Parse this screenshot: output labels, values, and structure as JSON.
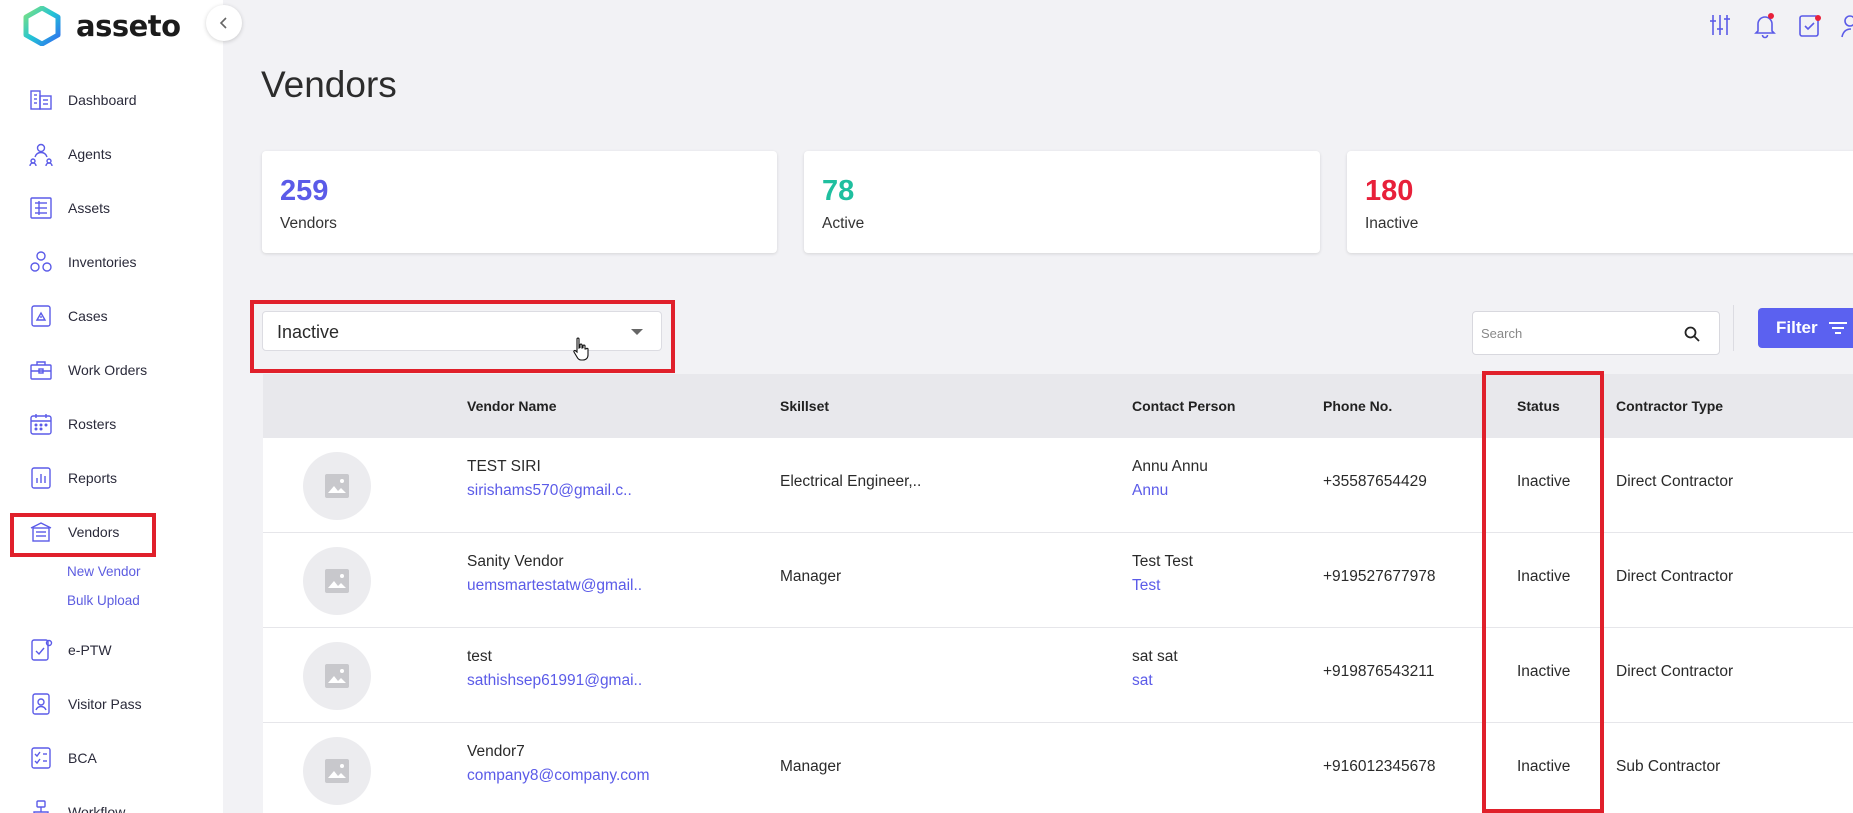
{
  "app": {
    "name": "asseto"
  },
  "sidebar": {
    "items": [
      {
        "label": "Dashboard",
        "icon": "dashboard-icon"
      },
      {
        "label": "Agents",
        "icon": "agents-icon"
      },
      {
        "label": "Assets",
        "icon": "assets-icon"
      },
      {
        "label": "Inventories",
        "icon": "inventories-icon"
      },
      {
        "label": "Cases",
        "icon": "cases-icon"
      },
      {
        "label": "Work Orders",
        "icon": "work-orders-icon"
      },
      {
        "label": "Rosters",
        "icon": "rosters-icon"
      },
      {
        "label": "Reports",
        "icon": "reports-icon"
      },
      {
        "label": "Vendors",
        "icon": "vendors-icon",
        "active": true
      },
      {
        "label": "e-PTW",
        "icon": "eptw-icon"
      },
      {
        "label": "Visitor Pass",
        "icon": "visitor-pass-icon"
      },
      {
        "label": "BCA",
        "icon": "bca-icon"
      },
      {
        "label": "Workflow",
        "icon": "workflow-icon"
      }
    ],
    "vendor_sub": {
      "new_vendor": "New Vendor",
      "bulk_upload": "Bulk Upload"
    }
  },
  "page": {
    "title": "Vendors"
  },
  "stats": [
    {
      "value": "259",
      "label": "Vendors",
      "color": "#5b5be8"
    },
    {
      "value": "78",
      "label": "Active",
      "color": "#1fbf9f"
    },
    {
      "value": "180",
      "label": "Inactive",
      "color": "#e8203a"
    }
  ],
  "status_select": {
    "value": "Inactive"
  },
  "search": {
    "placeholder": "Search"
  },
  "filter": {
    "label": "Filter"
  },
  "table": {
    "headers": {
      "vendor_name": "Vendor Name",
      "skillset": "Skillset",
      "contact_person": "Contact Person",
      "phone": "Phone No.",
      "status": "Status",
      "contractor_type": "Contractor Type"
    },
    "rows": [
      {
        "name": "TEST SIRI",
        "email": "sirishams570@gmail.c..",
        "skillset": "Electrical Engineer,..",
        "contact": "Annu Annu",
        "contact_short": "Annu",
        "phone": "+35587654429",
        "status": "Inactive",
        "contractor_type": "Direct Contractor"
      },
      {
        "name": "Sanity Vendor",
        "email": "uemsmartestatw@gmail..",
        "skillset": "Manager",
        "contact": "Test Test",
        "contact_short": "Test",
        "phone": "+919527677978",
        "status": "Inactive",
        "contractor_type": "Direct Contractor"
      },
      {
        "name": "test",
        "email": "sathishsep61991@gmai..",
        "skillset": "",
        "contact": "sat sat",
        "contact_short": "sat",
        "phone": "+919876543211",
        "status": "Inactive",
        "contractor_type": "Direct Contractor"
      },
      {
        "name": "Vendor7",
        "email": "company8@company.com",
        "skillset": "Manager",
        "contact": "",
        "contact_short": "",
        "phone": "+916012345678",
        "status": "Inactive",
        "contractor_type": "Sub Contractor"
      }
    ]
  },
  "colors": {
    "accent": "#5b61f0",
    "highlight": "#e0202b"
  }
}
